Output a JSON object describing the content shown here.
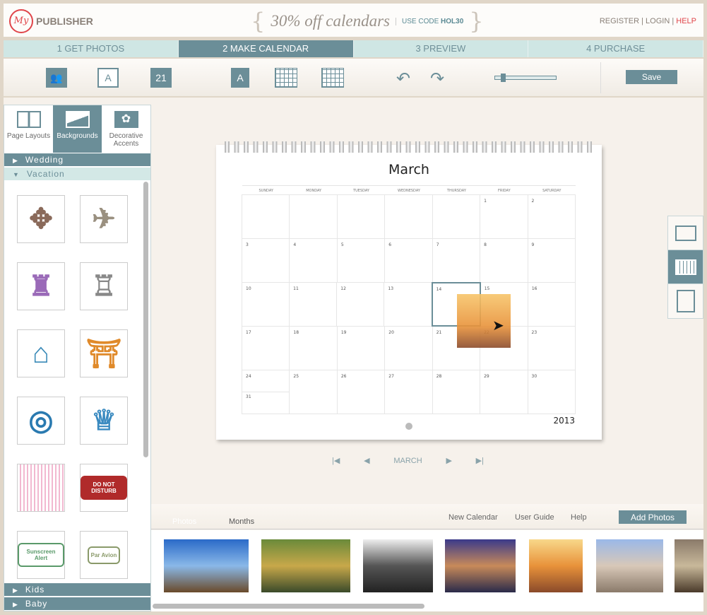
{
  "header": {
    "logo_my": "My",
    "logo_text": "PUBLISHER",
    "promo_main": "30% off calendars",
    "promo_code_label": "USE CODE",
    "promo_code": "HOL30",
    "links": [
      "REGISTER",
      "LOGIN",
      "HELP"
    ]
  },
  "steps": [
    {
      "label": "1 GET PHOTOS"
    },
    {
      "label": "2 MAKE CALENDAR",
      "active": true
    },
    {
      "label": "3 PREVIEW"
    },
    {
      "label": "4 PURCHASE"
    }
  ],
  "toolbar": {
    "text_icon": "A",
    "date_icon": "21",
    "save_label": "Save",
    "zoom_level": 0.1
  },
  "left_panel": {
    "tabs": [
      {
        "label": "Page Layouts"
      },
      {
        "label": "Backgrounds",
        "active": true
      },
      {
        "label": "Decorative Accents"
      }
    ],
    "categories_top": [
      {
        "label": "Wedding",
        "open": false
      },
      {
        "label": "Vacation",
        "open": true
      }
    ],
    "categories_bottom": [
      {
        "label": "Kids"
      },
      {
        "label": "Baby"
      }
    ],
    "stickers": [
      {
        "name": "compass",
        "text": "✥",
        "color": "#8a6a5a"
      },
      {
        "name": "airplane",
        "text": "✈",
        "color": "#9a9080"
      },
      {
        "name": "eiffel-stamp",
        "text": "♜",
        "color": "#9a6ab8"
      },
      {
        "name": "big-ben-stamp",
        "text": "♖",
        "color": "#888"
      },
      {
        "name": "tower-bridge-stamp",
        "text": "⌂",
        "color": "#3a8ab8"
      },
      {
        "name": "golden-gate-stamp",
        "text": "⛩",
        "color": "#e08a2a"
      },
      {
        "name": "golden-gate-circle",
        "text": "◎",
        "color": "#2a7ab0"
      },
      {
        "name": "statue-of-liberty",
        "text": "♕",
        "color": "#3a8ac0"
      },
      {
        "name": "door-hanger-pink",
        "text": "",
        "color": "#f2b8d0"
      },
      {
        "name": "do-not-disturb",
        "text": "DO NOT DISTURB",
        "color": "#b02a2a"
      },
      {
        "name": "sunscreen-alert",
        "text": "Sunscreen Alert",
        "color": "#5a9a6a"
      },
      {
        "name": "par-avion",
        "text": "Par Avion",
        "color": "#8a9a6a"
      }
    ]
  },
  "calendar": {
    "month": "March",
    "year": "2013",
    "days_of_week": [
      "SUNDAY",
      "MONDAY",
      "TUESDAY",
      "WEDNESDAY",
      "THURSDAY",
      "FRIDAY",
      "SATURDAY"
    ],
    "weeks": [
      [
        "",
        "",
        "",
        "",
        "",
        "1",
        "2"
      ],
      [
        "3",
        "4",
        "5",
        "6",
        "7",
        "8",
        "9"
      ],
      [
        "10",
        "11",
        "12",
        "13",
        "14",
        "15",
        "16"
      ],
      [
        "17",
        "18",
        "19",
        "20",
        "21",
        "22",
        "23"
      ],
      [
        "24",
        "25",
        "26",
        "27",
        "28",
        "29",
        "30"
      ]
    ],
    "extra_day": "31",
    "selected_day": "14"
  },
  "month_nav": {
    "first": "|◀",
    "prev": "◀",
    "label": "MARCH",
    "next": "▶",
    "last": "▶|"
  },
  "bottom_bar": {
    "tabs": [
      "Photos",
      "Months"
    ],
    "links": [
      "New Calendar",
      "User Guide",
      "Help"
    ],
    "add_photos": "Add Photos"
  },
  "photos": [
    {
      "name": "eiffel-tower-blue-sky",
      "colors": [
        "#2a6ac8",
        "#8ab8e8",
        "#6a4a2a"
      ]
    },
    {
      "name": "chateau-garden",
      "colors": [
        "#6a8a3a",
        "#c8a84a",
        "#3a4a2a"
      ]
    },
    {
      "name": "metro-sign",
      "colors": [
        "#eee",
        "#555",
        "#222"
      ]
    },
    {
      "name": "louvre-pyramid-dusk",
      "colors": [
        "#3a3a8a",
        "#c88a5a",
        "#2a2a4a"
      ]
    },
    {
      "name": "eiffel-sunset",
      "colors": [
        "#f8d88a",
        "#e8923a",
        "#8a4a2a"
      ]
    },
    {
      "name": "arc-de-triomphe",
      "colors": [
        "#9ab8e8",
        "#d8c8b8",
        "#8a7a6a"
      ]
    },
    {
      "name": "palace-interior",
      "colors": [
        "#8a7a6a",
        "#c8b89a",
        "#4a3a2a"
      ]
    }
  ]
}
